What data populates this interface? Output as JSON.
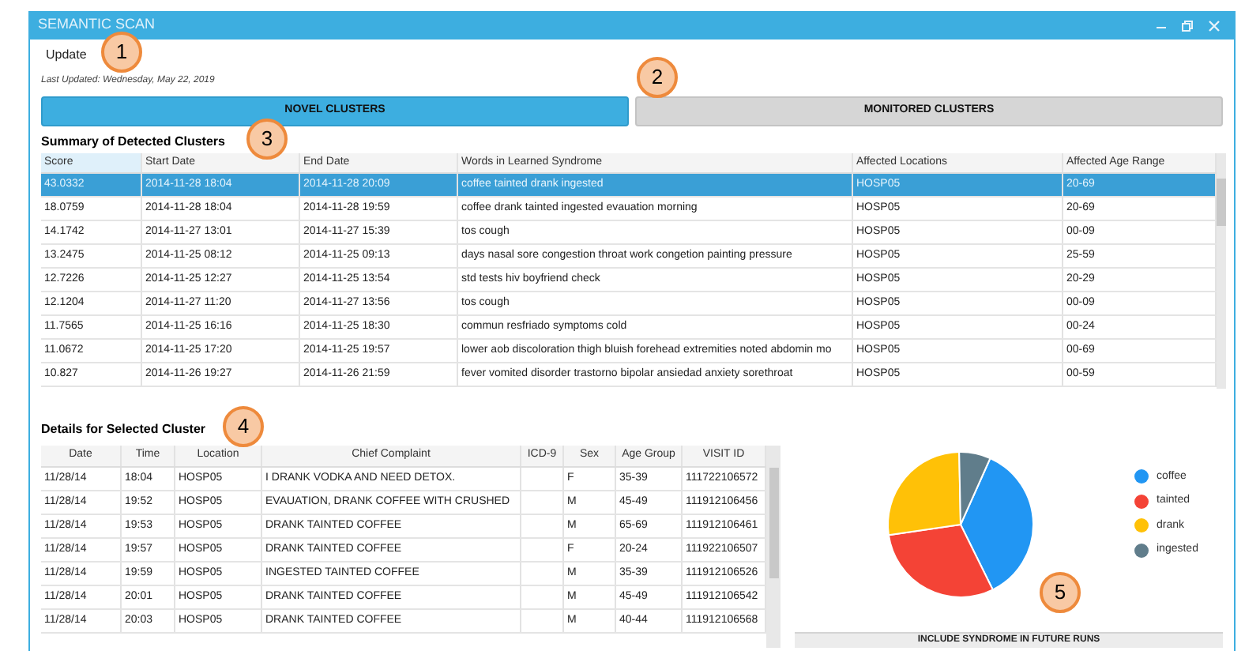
{
  "window": {
    "title": "SEMANTIC SCAN"
  },
  "menu": [
    "Update"
  ],
  "last_updated": "Last Updated: Wednesday, May 22, 2019",
  "tabs": [
    {
      "label": "NOVEL CLUSTERS",
      "selected": true
    },
    {
      "label": "MONITORED CLUSTERS",
      "selected": false
    }
  ],
  "summary": {
    "title": "Summary of Detected Clusters",
    "columns": [
      "Score",
      "Start Date",
      "End Date",
      "Words in Learned Syndrome",
      "Affected Locations",
      "Affected Age Range"
    ],
    "rows": [
      {
        "cells": [
          "43.0332",
          "2014-11-28 18:04",
          "2014-11-28 20:09",
          "coffee tainted drank ingested",
          "HOSP05",
          "20-69"
        ],
        "selected": true
      },
      {
        "cells": [
          "18.0759",
          "2014-11-28 18:04",
          "2014-11-28 19:59",
          "coffee drank tainted ingested evauation morning",
          "HOSP05",
          "20-69"
        ],
        "selected": false
      },
      {
        "cells": [
          "14.1742",
          "2014-11-27 13:01",
          "2014-11-27 15:39",
          "tos cough",
          "HOSP05",
          "00-09"
        ],
        "selected": false
      },
      {
        "cells": [
          "13.2475",
          "2014-11-25 08:12",
          "2014-11-25 09:13",
          "days nasal sore congestion throat work congetion painting pressure",
          "HOSP05",
          "25-59"
        ],
        "selected": false
      },
      {
        "cells": [
          "12.7226",
          "2014-11-25 12:27",
          "2014-11-25 13:54",
          "std tests hiv boyfriend check",
          "HOSP05",
          "20-29"
        ],
        "selected": false
      },
      {
        "cells": [
          "12.1204",
          "2014-11-27 11:20",
          "2014-11-27 13:56",
          "tos cough",
          "HOSP05",
          "00-09"
        ],
        "selected": false
      },
      {
        "cells": [
          "11.7565",
          "2014-11-25 16:16",
          "2014-11-25 18:30",
          "commun resfriado symptoms cold",
          "HOSP05",
          "00-24"
        ],
        "selected": false
      },
      {
        "cells": [
          "11.0672",
          "2014-11-25 17:20",
          "2014-11-25 19:57",
          "lower aob discoloration thigh bluish forehead extremities noted abdomin mo",
          "HOSP05",
          "00-69"
        ],
        "selected": false
      },
      {
        "cells": [
          "10.827",
          "2014-11-26 19:27",
          "2014-11-26 21:59",
          "fever vomited disorder trastorno bipolar ansiedad anxiety sorethroat",
          "HOSP05",
          "00-59"
        ],
        "selected": false
      }
    ]
  },
  "details": {
    "title": "Details for Selected Cluster",
    "columns": [
      "Date",
      "Time",
      "Location",
      "Chief Complaint",
      "ICD-9",
      "Sex",
      "Age Group",
      "VISIT ID"
    ],
    "rows": [
      [
        "11/28/14",
        "18:04",
        "HOSP05",
        "I DRANK VODKA AND NEED DETOX.",
        "",
        "F",
        "35-39",
        "111722106572"
      ],
      [
        "11/28/14",
        "19:52",
        "HOSP05",
        "EVAUATION, DRANK COFFEE WITH CRUSHED",
        "",
        "M",
        "45-49",
        "111912106456"
      ],
      [
        "11/28/14",
        "19:53",
        "HOSP05",
        "DRANK TAINTED COFFEE",
        "",
        "M",
        "65-69",
        "111912106461"
      ],
      [
        "11/28/14",
        "19:57",
        "HOSP05",
        "DRANK TAINTED COFFEE",
        "",
        "F",
        "20-24",
        "111922106507"
      ],
      [
        "11/28/14",
        "19:59",
        "HOSP05",
        "INGESTED TAINTED COFFEE",
        "",
        "M",
        "35-39",
        "111912106526"
      ],
      [
        "11/28/14",
        "20:01",
        "HOSP05",
        "DRANK TAINTED COFFEE",
        "",
        "M",
        "45-49",
        "111912106542"
      ],
      [
        "11/28/14",
        "20:03",
        "HOSP05",
        "DRANK TAINTED COFFEE",
        "",
        "M",
        "40-44",
        "111912106568"
      ]
    ]
  },
  "legend": [
    {
      "label": "coffee",
      "color": "#2196f3"
    },
    {
      "label": "tainted",
      "color": "#f44336"
    },
    {
      "label": "drank",
      "color": "#ffc107"
    },
    {
      "label": "ingested",
      "color": "#607d8b"
    }
  ],
  "include_button": "INCLUDE SYNDROME IN FUTURE RUNS",
  "callouts": [
    "1",
    "2",
    "3",
    "4",
    "5"
  ]
}
